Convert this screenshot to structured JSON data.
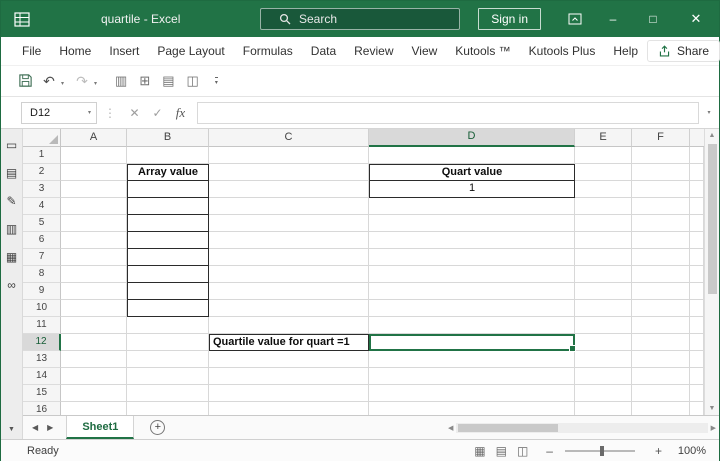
{
  "title_bar": {
    "app_title": "quartile - Excel",
    "search_placeholder": "Search",
    "sign_in_label": "Sign in"
  },
  "menu_bar": {
    "tabs": [
      {
        "label": "File"
      },
      {
        "label": "Home"
      },
      {
        "label": "Insert"
      },
      {
        "label": "Page Layout"
      },
      {
        "label": "Formulas"
      },
      {
        "label": "Data"
      },
      {
        "label": "Review"
      },
      {
        "label": "View"
      },
      {
        "label": "Kutools ™"
      },
      {
        "label": "Kutools Plus"
      },
      {
        "label": "Help"
      }
    ],
    "share_label": "Share"
  },
  "quick_access": {
    "custom_icons": [
      {
        "name": "custom-command-icon-1",
        "glyph": "▥"
      },
      {
        "name": "custom-command-icon-2",
        "glyph": "⊞"
      },
      {
        "name": "custom-command-icon-3",
        "glyph": "▤"
      },
      {
        "name": "custom-command-icon-4",
        "glyph": "◫"
      }
    ]
  },
  "formula_bar": {
    "name_box_value": "D12",
    "insert_function_label": "fx",
    "formula_value": ""
  },
  "sidebar": {
    "icons": [
      {
        "name": "pane-toggle-icon",
        "glyph": "▭"
      },
      {
        "name": "workbook-pane-icon",
        "glyph": "▤"
      },
      {
        "name": "edit-pane-icon",
        "glyph": "✎"
      },
      {
        "name": "print-pane-icon",
        "glyph": "▥"
      },
      {
        "name": "columns-pane-icon",
        "glyph": "▦"
      },
      {
        "name": "find-pane-icon",
        "glyph": "∞"
      }
    ]
  },
  "sheet": {
    "column_headers": [
      "A",
      "B",
      "C",
      "D",
      "E",
      "F"
    ],
    "row_count": 16,
    "selection": {
      "active_cell": "D12",
      "column": "D",
      "row": 12
    },
    "cells": [
      {
        "ref": "B2",
        "text": "Array value",
        "bold": true,
        "align": "center",
        "border": true
      },
      {
        "ref": "B3",
        "text": "",
        "border": true
      },
      {
        "ref": "B4",
        "text": "",
        "border": true
      },
      {
        "ref": "B5",
        "text": "",
        "border": true
      },
      {
        "ref": "B6",
        "text": "",
        "border": true
      },
      {
        "ref": "B7",
        "text": "",
        "border": true
      },
      {
        "ref": "B8",
        "text": "",
        "border": true
      },
      {
        "ref": "B9",
        "text": "",
        "border": true
      },
      {
        "ref": "B10",
        "text": "",
        "border": true
      },
      {
        "ref": "D2",
        "text": "Quart value",
        "bold": true,
        "align": "center",
        "border": true
      },
      {
        "ref": "D3",
        "text": "1",
        "align": "center",
        "border": true
      },
      {
        "ref": "C12",
        "text": "Quartile value for quart =1",
        "bold": true,
        "align": "left",
        "border": true
      }
    ]
  },
  "sheet_tabs": {
    "active_tab": "Sheet1"
  },
  "status_bar": {
    "mode": "Ready",
    "zoom_level": "100%"
  },
  "colors": {
    "excel_green": "#217346",
    "selection_border": "#217346",
    "cell_border_dark": "#2b2b2b",
    "gridline": "#d8d8d8"
  },
  "icons": {
    "minimize": "–",
    "maximize": "□",
    "close": "✕",
    "undo": "↶",
    "redo": "↷",
    "dropdown": "▾",
    "cancel": "✕",
    "enter": "✓",
    "separator_dots": "⋮",
    "scroll_up": "▲",
    "scroll_down": "▼",
    "scroll_left": "◀",
    "scroll_right": "▶",
    "new_sheet": "+",
    "zoom_out": "–",
    "zoom_in": "+",
    "view_normal": "▦",
    "view_layout": "▤",
    "view_break": "◫",
    "sidebar_collapse": "▼"
  }
}
